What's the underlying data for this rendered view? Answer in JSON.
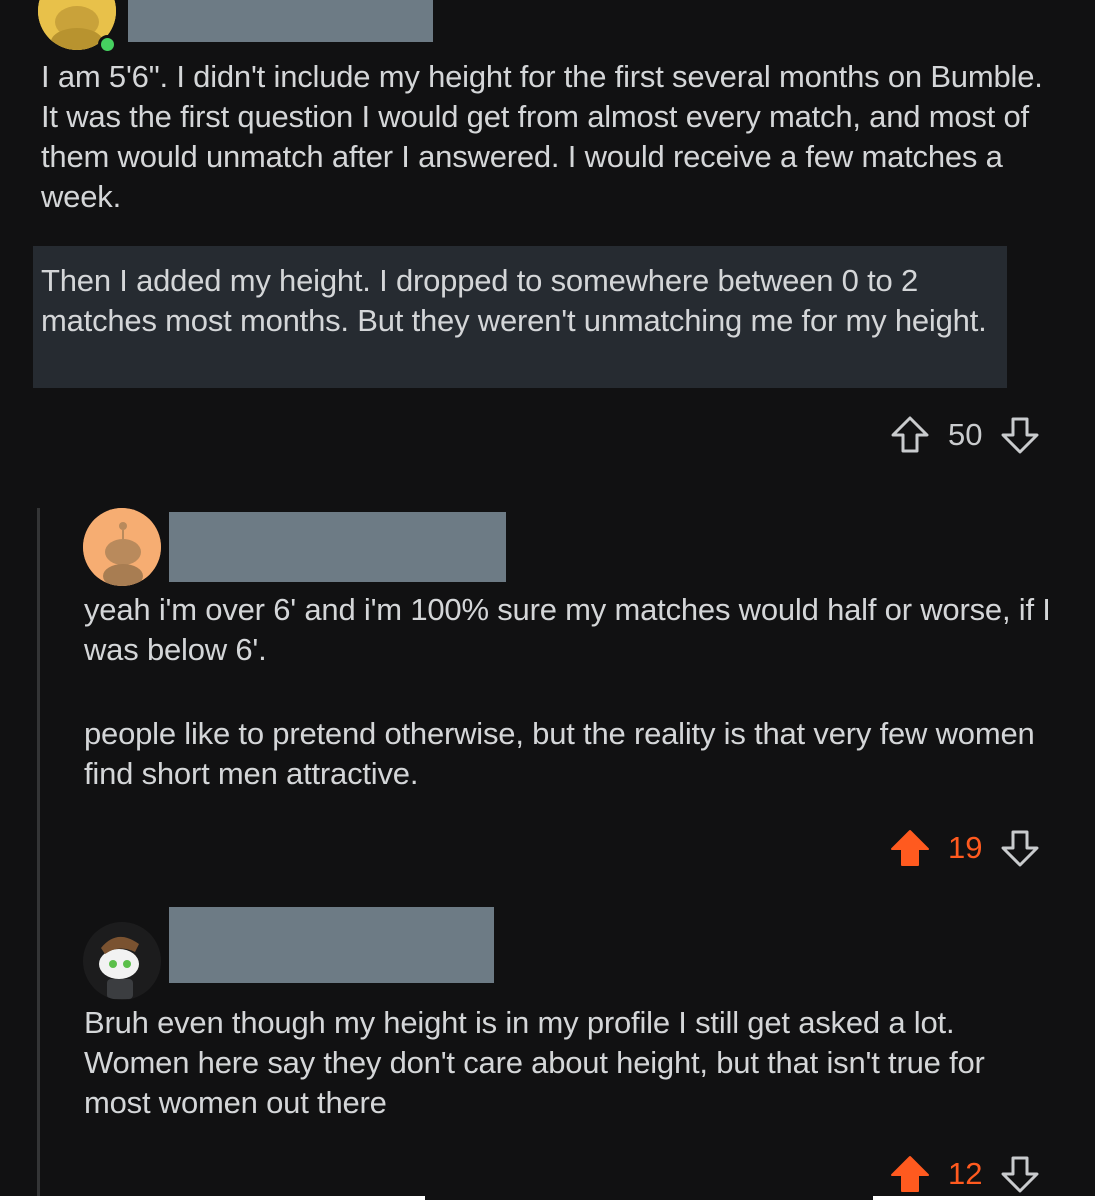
{
  "colors": {
    "background": "#111112",
    "text": "#d4d6d8",
    "upvote_active": "#ff5a1f",
    "redaction": "#6d7b85",
    "highlight": "#262b31"
  },
  "comments": [
    {
      "avatar": "snoo-avatar-yellow",
      "online_indicator": true,
      "paragraphs": [
        "I am 5'6\". I didn't include my height for the first several months on Bumble. It was the first question I would get from almost every match, and most of them would unmatch after I answered. I would receive a few matches a week.",
        "Then I added my height. I dropped to somewhere between 0 to 2 matches most months. But they weren't unmatching me for my height."
      ],
      "score": "50",
      "upvoted": false
    },
    {
      "avatar": "snoo-avatar-orange",
      "paragraphs": [
        "yeah i'm over 6' and i'm 100% sure my matches would half or worse, if I was below 6'.",
        "people like to pretend otherwise, but the reality is that very few women find short men attractive."
      ],
      "score": "19",
      "upvoted": true
    },
    {
      "avatar": "snoo-avatar-custom",
      "paragraphs": [
        "Bruh even though my height is in my profile I still get asked a lot. Women here say they don't care about height, but that isn't true for most women out there"
      ],
      "score": "12",
      "upvoted": true
    }
  ]
}
